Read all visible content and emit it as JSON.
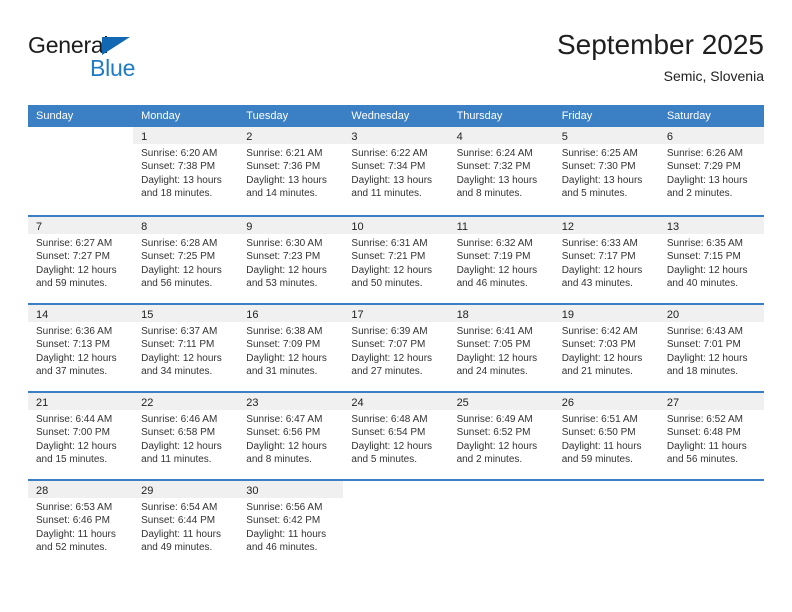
{
  "brand": {
    "name_part1": "General",
    "name_part2": "Blue",
    "triangle_color": "#1268b3",
    "blue_color": "#1f7cc4"
  },
  "header": {
    "title": "September 2025",
    "subtitle": "Semic, Slovenia"
  },
  "theme": {
    "header_row_bg": "#3b7fc4",
    "header_row_text": "#ffffff",
    "row_separator": "#3b7fc4",
    "daynum_band_bg": "#f0f0f0",
    "body_text": "#333333"
  },
  "weekdays": [
    "Sunday",
    "Monday",
    "Tuesday",
    "Wednesday",
    "Thursday",
    "Friday",
    "Saturday"
  ],
  "weeks": [
    [
      {
        "day": "",
        "l1": "",
        "l2": "",
        "l3": "",
        "l4": ""
      },
      {
        "day": "1",
        "l1": "Sunrise: 6:20 AM",
        "l2": "Sunset: 7:38 PM",
        "l3": "Daylight: 13 hours",
        "l4": "and 18 minutes."
      },
      {
        "day": "2",
        "l1": "Sunrise: 6:21 AM",
        "l2": "Sunset: 7:36 PM",
        "l3": "Daylight: 13 hours",
        "l4": "and 14 minutes."
      },
      {
        "day": "3",
        "l1": "Sunrise: 6:22 AM",
        "l2": "Sunset: 7:34 PM",
        "l3": "Daylight: 13 hours",
        "l4": "and 11 minutes."
      },
      {
        "day": "4",
        "l1": "Sunrise: 6:24 AM",
        "l2": "Sunset: 7:32 PM",
        "l3": "Daylight: 13 hours",
        "l4": "and 8 minutes."
      },
      {
        "day": "5",
        "l1": "Sunrise: 6:25 AM",
        "l2": "Sunset: 7:30 PM",
        "l3": "Daylight: 13 hours",
        "l4": "and 5 minutes."
      },
      {
        "day": "6",
        "l1": "Sunrise: 6:26 AM",
        "l2": "Sunset: 7:29 PM",
        "l3": "Daylight: 13 hours",
        "l4": "and 2 minutes."
      }
    ],
    [
      {
        "day": "7",
        "l1": "Sunrise: 6:27 AM",
        "l2": "Sunset: 7:27 PM",
        "l3": "Daylight: 12 hours",
        "l4": "and 59 minutes."
      },
      {
        "day": "8",
        "l1": "Sunrise: 6:28 AM",
        "l2": "Sunset: 7:25 PM",
        "l3": "Daylight: 12 hours",
        "l4": "and 56 minutes."
      },
      {
        "day": "9",
        "l1": "Sunrise: 6:30 AM",
        "l2": "Sunset: 7:23 PM",
        "l3": "Daylight: 12 hours",
        "l4": "and 53 minutes."
      },
      {
        "day": "10",
        "l1": "Sunrise: 6:31 AM",
        "l2": "Sunset: 7:21 PM",
        "l3": "Daylight: 12 hours",
        "l4": "and 50 minutes."
      },
      {
        "day": "11",
        "l1": "Sunrise: 6:32 AM",
        "l2": "Sunset: 7:19 PM",
        "l3": "Daylight: 12 hours",
        "l4": "and 46 minutes."
      },
      {
        "day": "12",
        "l1": "Sunrise: 6:33 AM",
        "l2": "Sunset: 7:17 PM",
        "l3": "Daylight: 12 hours",
        "l4": "and 43 minutes."
      },
      {
        "day": "13",
        "l1": "Sunrise: 6:35 AM",
        "l2": "Sunset: 7:15 PM",
        "l3": "Daylight: 12 hours",
        "l4": "and 40 minutes."
      }
    ],
    [
      {
        "day": "14",
        "l1": "Sunrise: 6:36 AM",
        "l2": "Sunset: 7:13 PM",
        "l3": "Daylight: 12 hours",
        "l4": "and 37 minutes."
      },
      {
        "day": "15",
        "l1": "Sunrise: 6:37 AM",
        "l2": "Sunset: 7:11 PM",
        "l3": "Daylight: 12 hours",
        "l4": "and 34 minutes."
      },
      {
        "day": "16",
        "l1": "Sunrise: 6:38 AM",
        "l2": "Sunset: 7:09 PM",
        "l3": "Daylight: 12 hours",
        "l4": "and 31 minutes."
      },
      {
        "day": "17",
        "l1": "Sunrise: 6:39 AM",
        "l2": "Sunset: 7:07 PM",
        "l3": "Daylight: 12 hours",
        "l4": "and 27 minutes."
      },
      {
        "day": "18",
        "l1": "Sunrise: 6:41 AM",
        "l2": "Sunset: 7:05 PM",
        "l3": "Daylight: 12 hours",
        "l4": "and 24 minutes."
      },
      {
        "day": "19",
        "l1": "Sunrise: 6:42 AM",
        "l2": "Sunset: 7:03 PM",
        "l3": "Daylight: 12 hours",
        "l4": "and 21 minutes."
      },
      {
        "day": "20",
        "l1": "Sunrise: 6:43 AM",
        "l2": "Sunset: 7:01 PM",
        "l3": "Daylight: 12 hours",
        "l4": "and 18 minutes."
      }
    ],
    [
      {
        "day": "21",
        "l1": "Sunrise: 6:44 AM",
        "l2": "Sunset: 7:00 PM",
        "l3": "Daylight: 12 hours",
        "l4": "and 15 minutes."
      },
      {
        "day": "22",
        "l1": "Sunrise: 6:46 AM",
        "l2": "Sunset: 6:58 PM",
        "l3": "Daylight: 12 hours",
        "l4": "and 11 minutes."
      },
      {
        "day": "23",
        "l1": "Sunrise: 6:47 AM",
        "l2": "Sunset: 6:56 PM",
        "l3": "Daylight: 12 hours",
        "l4": "and 8 minutes."
      },
      {
        "day": "24",
        "l1": "Sunrise: 6:48 AM",
        "l2": "Sunset: 6:54 PM",
        "l3": "Daylight: 12 hours",
        "l4": "and 5 minutes."
      },
      {
        "day": "25",
        "l1": "Sunrise: 6:49 AM",
        "l2": "Sunset: 6:52 PM",
        "l3": "Daylight: 12 hours",
        "l4": "and 2 minutes."
      },
      {
        "day": "26",
        "l1": "Sunrise: 6:51 AM",
        "l2": "Sunset: 6:50 PM",
        "l3": "Daylight: 11 hours",
        "l4": "and 59 minutes."
      },
      {
        "day": "27",
        "l1": "Sunrise: 6:52 AM",
        "l2": "Sunset: 6:48 PM",
        "l3": "Daylight: 11 hours",
        "l4": "and 56 minutes."
      }
    ],
    [
      {
        "day": "28",
        "l1": "Sunrise: 6:53 AM",
        "l2": "Sunset: 6:46 PM",
        "l3": "Daylight: 11 hours",
        "l4": "and 52 minutes."
      },
      {
        "day": "29",
        "l1": "Sunrise: 6:54 AM",
        "l2": "Sunset: 6:44 PM",
        "l3": "Daylight: 11 hours",
        "l4": "and 49 minutes."
      },
      {
        "day": "30",
        "l1": "Sunrise: 6:56 AM",
        "l2": "Sunset: 6:42 PM",
        "l3": "Daylight: 11 hours",
        "l4": "and 46 minutes."
      },
      {
        "day": "",
        "l1": "",
        "l2": "",
        "l3": "",
        "l4": ""
      },
      {
        "day": "",
        "l1": "",
        "l2": "",
        "l3": "",
        "l4": ""
      },
      {
        "day": "",
        "l1": "",
        "l2": "",
        "l3": "",
        "l4": ""
      },
      {
        "day": "",
        "l1": "",
        "l2": "",
        "l3": "",
        "l4": ""
      }
    ]
  ]
}
